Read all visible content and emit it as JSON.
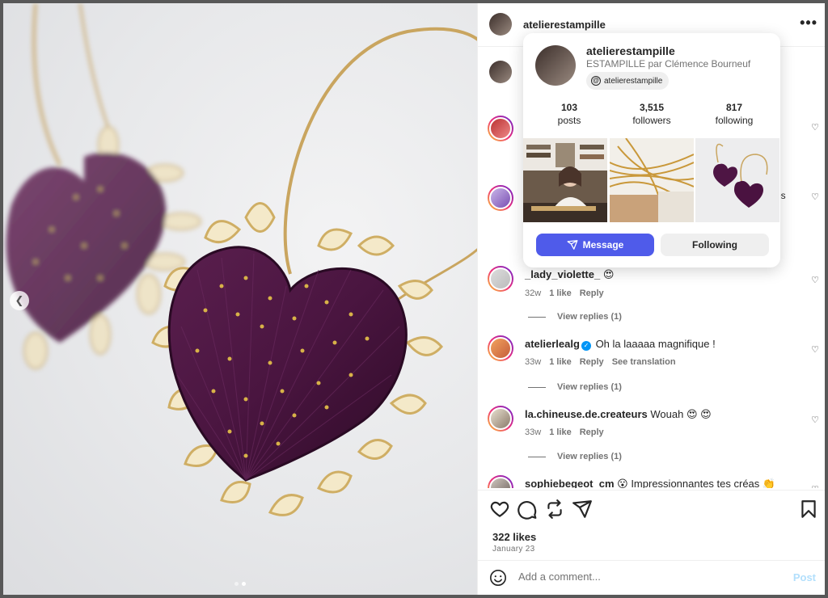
{
  "post": {
    "username": "atelierestampille",
    "more_label": "•••"
  },
  "card": {
    "username": "atelierestampille",
    "full_name": "ESTAMPILLE par Clémence Bourneuf",
    "threads_handle": "atelierestampille",
    "stats": [
      {
        "num": "103",
        "label": "posts"
      },
      {
        "num": "3,515",
        "label": "followers"
      },
      {
        "num": "817",
        "label": "following"
      }
    ],
    "message_label": "Message",
    "following_label": "Following"
  },
  "comments": [
    {
      "user": "_lady_violette_",
      "text": "😍",
      "time": "32w",
      "likes": "1 like",
      "reply": "Reply",
      "view_replies": "View replies (1)"
    },
    {
      "user": "atelierlealg",
      "verified": true,
      "text": "Oh la laaaaa magnifique !",
      "time": "33w",
      "likes": "1 like",
      "reply": "Reply",
      "translate": "See translation",
      "view_replies": "View replies (1)"
    },
    {
      "user": "la.chineuse.de.createurs",
      "text": "Wouah 😍 😍",
      "time": "33w",
      "likes": "1 like",
      "reply": "Reply",
      "view_replies": "View replies (1)"
    },
    {
      "user": "sophiebegeot_cm",
      "text": "😮 Impressionnantes tes créas 👏"
    }
  ],
  "hidden_comment_tail": "es",
  "likes_count": "322 likes",
  "date": "January 23",
  "comment_input": {
    "placeholder": "Add a comment..."
  },
  "post_button": "Post",
  "carousel": {
    "total": 2,
    "active": 2
  },
  "icons": [
    "heart-icon",
    "comment-icon",
    "repost-icon",
    "share-icon",
    "save-icon",
    "emoji-icon",
    "chevron-left-icon",
    "more-icon",
    "threads-icon"
  ],
  "colors": {
    "message_button": "#4f5bea",
    "post_link": "#b2dffc",
    "verified": "#0095f6"
  }
}
